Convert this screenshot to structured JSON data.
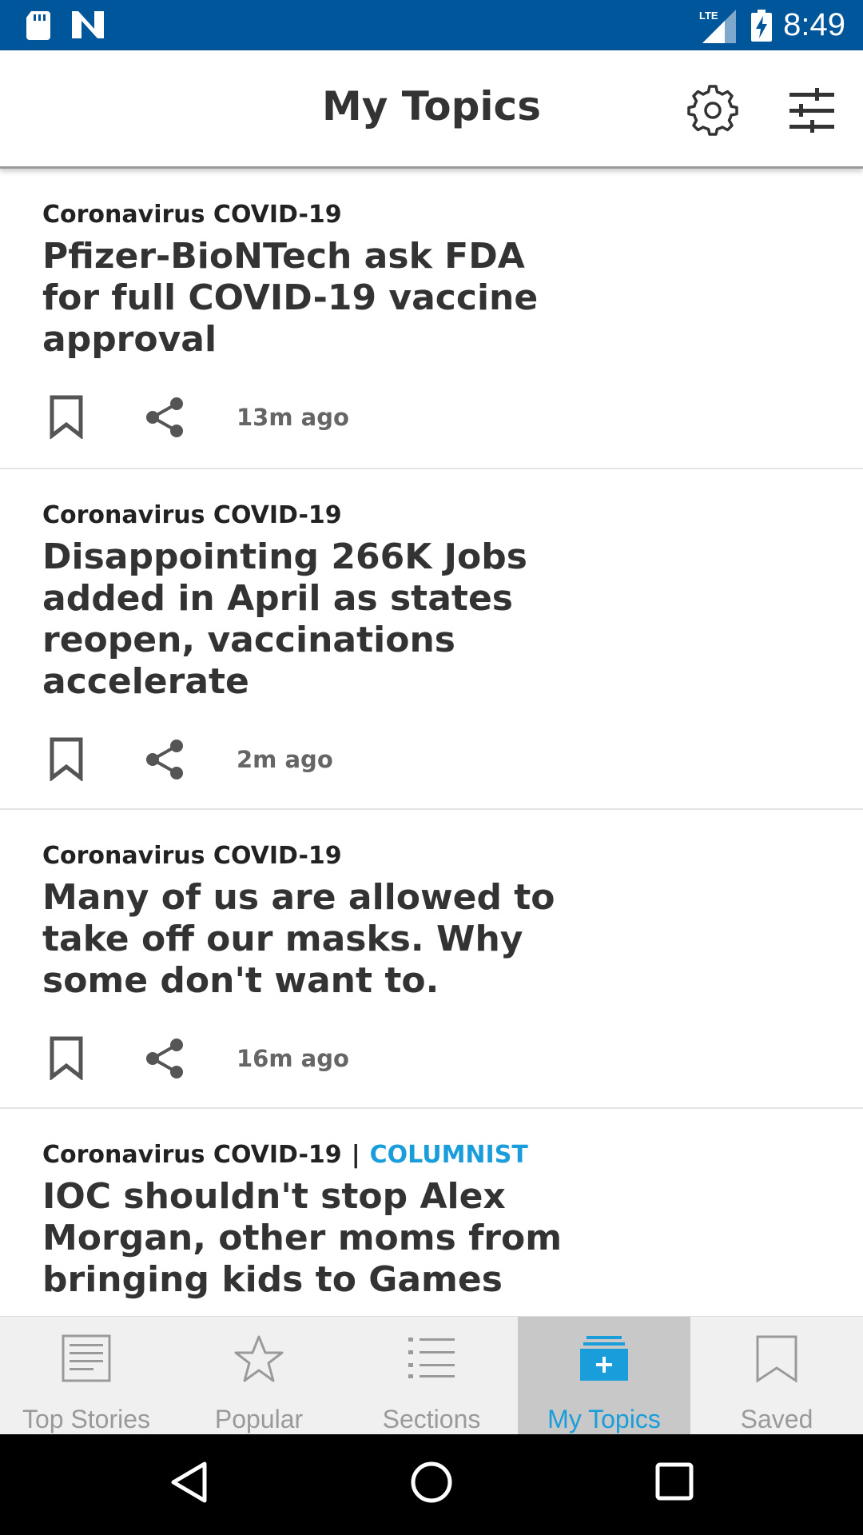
{
  "status_bar": {
    "time": "8:49",
    "network": "LTE",
    "icons": [
      "sd-card-icon",
      "n-notification-icon",
      "lte-signal-icon",
      "battery-charging-icon"
    ]
  },
  "header": {
    "title": "My Topics",
    "icons": [
      "gear-icon",
      "filter-sliders-icon"
    ]
  },
  "stories": [
    {
      "topic": "Coronavirus COVID-19",
      "label": "",
      "headline": "Pfizer-BioNTech ask FDA for full COVID-19 vaccine approval",
      "time": "13m ago"
    },
    {
      "topic": "Coronavirus COVID-19",
      "label": "",
      "headline": "Disappointing 266K Jobs added in April as states reopen, vaccinations accelerate",
      "time": "2m ago"
    },
    {
      "topic": "Coronavirus COVID-19",
      "label": "",
      "headline": "Many of us are allowed to take off our masks. Why some don't want to.",
      "time": "16m ago"
    },
    {
      "topic": "Coronavirus COVID-19",
      "separator": "|",
      "label": "COLUMNIST",
      "headline": "IOC shouldn't stop Alex Morgan, other moms from bringing kids to Games",
      "time": ""
    }
  ],
  "bottom_nav": {
    "tabs": [
      {
        "label": "Top Stories",
        "icon": "newspaper-icon"
      },
      {
        "label": "Popular",
        "icon": "star-icon"
      },
      {
        "label": "Sections",
        "icon": "list-icon"
      },
      {
        "label": "My Topics",
        "icon": "my-topics-icon",
        "active": true
      },
      {
        "label": "Saved",
        "icon": "bookmark-icon"
      }
    ]
  },
  "colors": {
    "status_bar": "#00569a",
    "accent": "#1a9ddb",
    "active_tab_bg": "#c8c8c8",
    "text": "#333333"
  }
}
